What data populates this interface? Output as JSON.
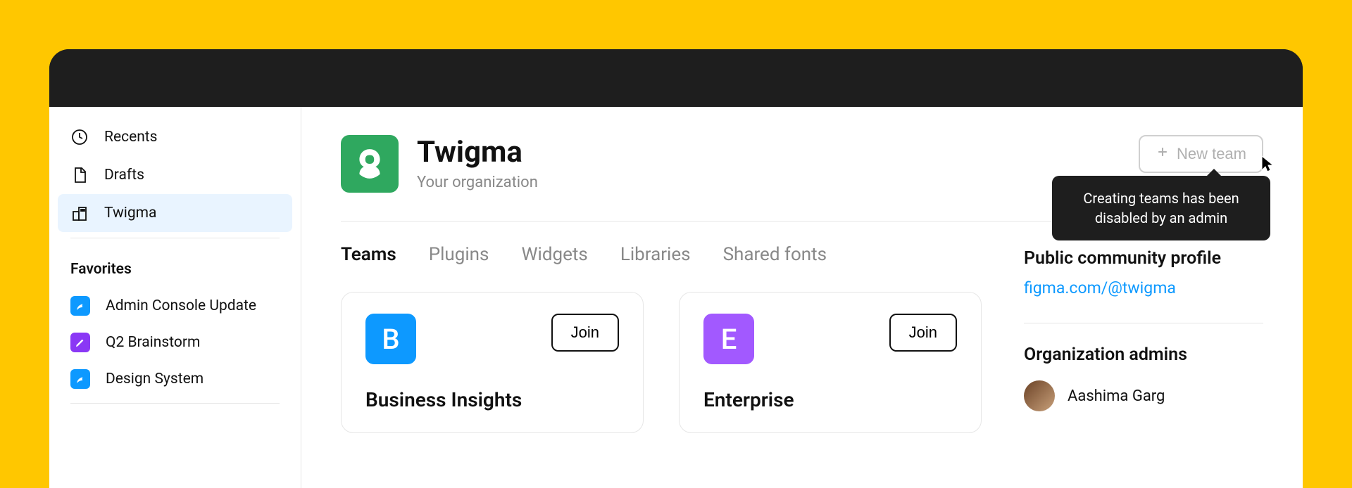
{
  "sidebar": {
    "nav": [
      {
        "label": "Recents",
        "icon": "clock"
      },
      {
        "label": "Drafts",
        "icon": "file"
      },
      {
        "label": "Twigma",
        "icon": "building",
        "active": true
      }
    ],
    "favorites_header": "Favorites",
    "favorites": [
      {
        "label": "Admin Console Update",
        "color": "blue",
        "icon": "leaf"
      },
      {
        "label": "Q2 Brainstorm",
        "color": "purple",
        "icon": "pencil"
      },
      {
        "label": "Design System",
        "color": "blue",
        "icon": "leaf"
      }
    ]
  },
  "org": {
    "name": "Twigma",
    "subtitle": "Your organization"
  },
  "new_team_label": "New team",
  "tooltip_text": "Creating teams has been disabled by an admin",
  "tabs": [
    {
      "label": "Teams",
      "active": true
    },
    {
      "label": "Plugins"
    },
    {
      "label": "Widgets"
    },
    {
      "label": "Libraries"
    },
    {
      "label": "Shared fonts"
    }
  ],
  "teams": [
    {
      "initial": "B",
      "name": "Business Insights",
      "color": "blue",
      "join_label": "Join"
    },
    {
      "initial": "E",
      "name": "Enterprise",
      "color": "purple",
      "join_label": "Join"
    }
  ],
  "profile": {
    "header": "Public community profile",
    "link": "figma.com/@twigma"
  },
  "admins": {
    "header": "Organization admins",
    "list": [
      {
        "name": "Aashima Garg"
      }
    ]
  }
}
